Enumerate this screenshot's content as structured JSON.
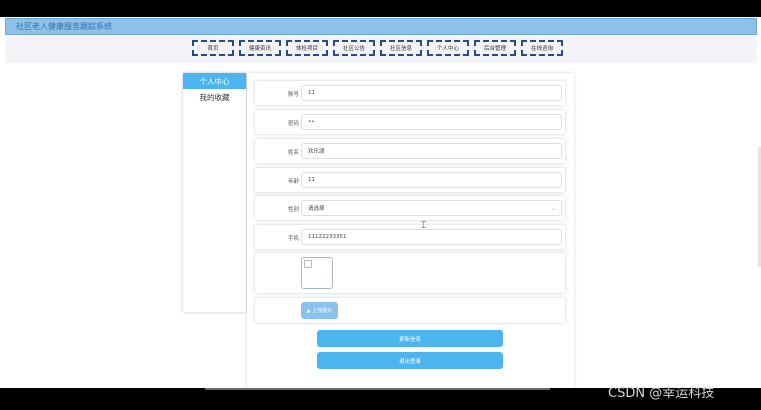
{
  "app": {
    "title": "社区老人健康服务跟踪系统"
  },
  "nav": {
    "items": [
      "首页",
      "健康资讯",
      "体检项目",
      "社区公告",
      "社区信息",
      "个人中心",
      "后台管理",
      "在线咨询"
    ]
  },
  "sidebar": {
    "items": [
      {
        "label": "个人中心",
        "active": true
      },
      {
        "label": "我的收藏",
        "active": false
      }
    ]
  },
  "form": {
    "account": {
      "label": "账号",
      "value": "11"
    },
    "password": {
      "label": "密码",
      "value": "••"
    },
    "name": {
      "label": "姓名",
      "value": "欢乐颂"
    },
    "age": {
      "label": "年龄",
      "value": "11"
    },
    "gender": {
      "label": "性别",
      "value": "请选择"
    },
    "phone": {
      "label": "手机",
      "value": "11122233351"
    },
    "upload_label": "上传图片"
  },
  "buttons": {
    "update": "更新信息",
    "logout": "退出登录"
  },
  "watermark": "CSDN @幸运科技",
  "icons": {
    "upload": "upload-icon",
    "chevron": "chevron-down-icon",
    "broken_image": "broken-image-icon"
  },
  "colors": {
    "accent": "#4cb4ee",
    "titlebar": "#8ec1ea",
    "nav_border": "#2a4a85"
  }
}
